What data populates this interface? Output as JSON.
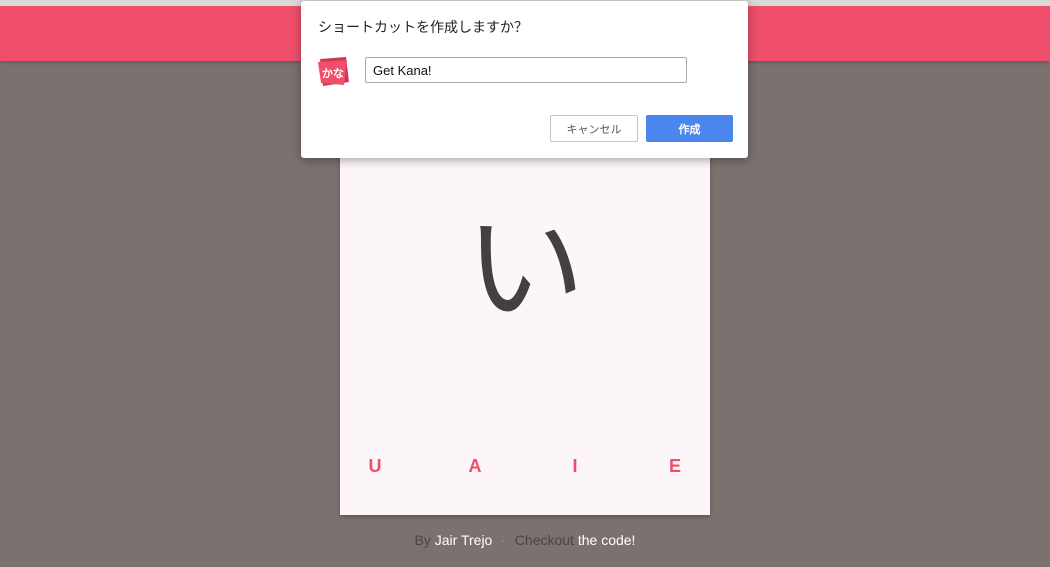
{
  "colors": {
    "header": "#ef4f6b",
    "background": "#7b7270",
    "card": "#fdf6f9",
    "accent": "#ef4f6b",
    "primary_button": "#4a86ee"
  },
  "card": {
    "kana": "い",
    "answers": [
      "U",
      "A",
      "I",
      "E"
    ]
  },
  "footer": {
    "by": "By",
    "author": "Jair Trejo",
    "separator": "·",
    "checkout": "Checkout",
    "code_link": "the code!"
  },
  "dialog": {
    "title": "ショートカットを作成しますか？",
    "app_icon_text": "かな",
    "app_icon_name": "get-kana-app-icon",
    "name_value": "Get Kana!",
    "cancel_label": "キャンセル",
    "create_label": "作成"
  }
}
